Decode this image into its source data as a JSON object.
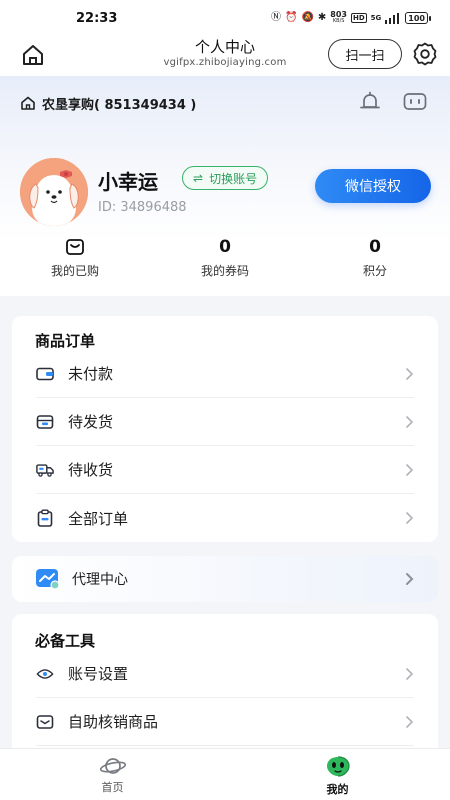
{
  "status_bar": {
    "time": "22:33",
    "network_speed_top": "803",
    "network_speed_unit": "KB/S",
    "hd_label": "HD",
    "signal_label": "5G",
    "battery": "100"
  },
  "header": {
    "title": "个人中心",
    "subtitle": "vgifpx.zhibojiaying.com",
    "scan_label": "扫一扫"
  },
  "store": {
    "name": "农垦享购( 851349434 )"
  },
  "user": {
    "name": "小幸运",
    "switch_label": "切换账号",
    "switch_glyph": "⇌",
    "id_text": "ID: 34896488",
    "auth_label": "微信授权"
  },
  "stats": [
    {
      "value": "",
      "label": "我的已购",
      "icon": "purchased-icon"
    },
    {
      "value": "0",
      "label": "我的券码"
    },
    {
      "value": "0",
      "label": "积分"
    }
  ],
  "orders": {
    "title": "商品订单",
    "items": [
      {
        "label": "未付款",
        "icon": "wallet-icon"
      },
      {
        "label": "待发货",
        "icon": "box-icon"
      },
      {
        "label": "待收货",
        "icon": "truck-icon"
      },
      {
        "label": "全部订单",
        "icon": "clipboard-icon"
      }
    ]
  },
  "agent": {
    "label": "代理中心",
    "icon": "agent-chart-icon"
  },
  "tools": {
    "title": "必备工具",
    "items": [
      {
        "label": "账号设置",
        "icon": "eye-icon"
      },
      {
        "label": "自助核销商品",
        "icon": "tray-icon"
      }
    ]
  },
  "bottom_nav": {
    "items": [
      {
        "label": "首页",
        "icon": "planet-icon"
      },
      {
        "label": "我的",
        "icon": "alien-icon"
      }
    ]
  },
  "colors": {
    "accent_blue": "#1f74ee",
    "switch_green": "#2c9e5c",
    "avatar_bg": "#f4a37e",
    "nav_active": "#2eb85c"
  }
}
